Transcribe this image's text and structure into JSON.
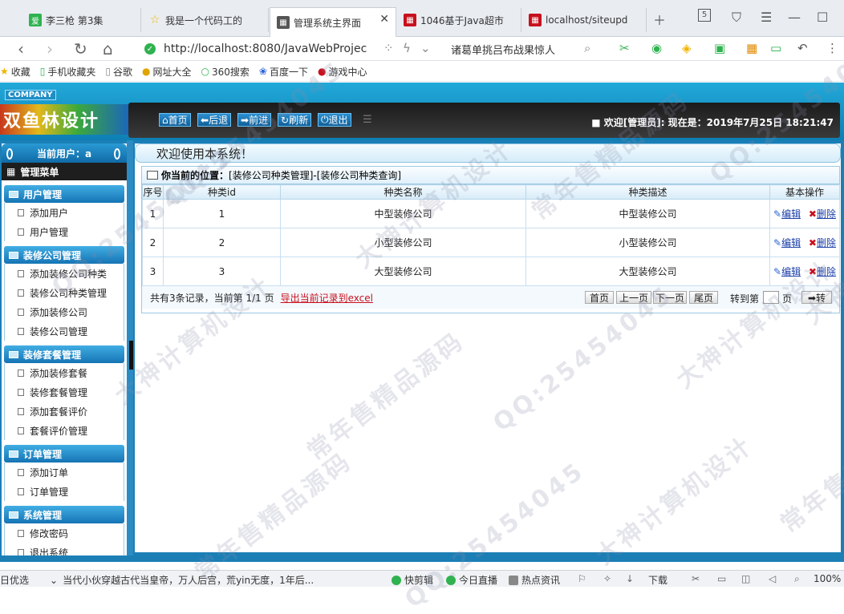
{
  "browser": {
    "tabs": [
      {
        "label": "李三枪 第3集",
        "fav_color": "#2fb24f",
        "fav_text": "爱"
      },
      {
        "label": "我是一个代码工的",
        "fav_color": "#f0b400",
        "fav_text": "☆"
      },
      {
        "label": "管理系统主界面",
        "fav_color": "#555555",
        "fav_text": "▦"
      },
      {
        "label": "1046基于Java超市",
        "fav_color": "#c8101d",
        "fav_text": "▦"
      },
      {
        "label": "localhost/siteupd",
        "fav_color": "#c8101d",
        "fav_text": "▦"
      }
    ],
    "active_tab": 2,
    "tab_count_badge": "5",
    "url": "http://localhost:8080/JavaWebProjec",
    "search_text": "诸葛单挑吕布战果惊人",
    "bookmarks": [
      {
        "label": "收藏",
        "icon": "star-icon"
      },
      {
        "label": "手机收藏夹",
        "icon": "phone-icon"
      },
      {
        "label": "谷歌",
        "icon": "page-icon"
      },
      {
        "label": "网址大全",
        "icon": "globe-icon"
      },
      {
        "label": "360搜索",
        "icon": "search-icon"
      },
      {
        "label": "百度一下",
        "icon": "paw-icon"
      },
      {
        "label": "游戏中心",
        "icon": "game-icon"
      }
    ]
  },
  "app": {
    "company": "COMPANY",
    "logo_text": "双鱼林设计",
    "menu": [
      "首页",
      "后退",
      "前进",
      "刷新",
      "退出"
    ],
    "welcome": "欢迎[管理员]:  现在是：2019年7月25日 18:21:47",
    "current_user": "当前用户：a",
    "mgmt_menu": "管理菜单",
    "welcome_bar": "欢迎使用本系统！",
    "sidebar": [
      {
        "group": "用户管理",
        "items": [
          "添加用户",
          "用户管理"
        ]
      },
      {
        "group": "装修公司管理",
        "items": [
          "添加装修公司种类",
          "装修公司种类管理",
          "添加装修公司",
          "装修公司管理"
        ]
      },
      {
        "group": "装修套餐管理",
        "items": [
          "添加装修套餐",
          "装修套餐管理",
          "添加套餐评价",
          "套餐评价管理"
        ]
      },
      {
        "group": "订单管理",
        "items": [
          "添加订单",
          "订单管理"
        ]
      },
      {
        "group": "系统管理",
        "items": [
          "修改密码",
          "退出系统"
        ]
      }
    ],
    "breadcrumb_label": "你当前的位置：",
    "breadcrumb_path": "[装修公司种类管理]-[装修公司种类查询]",
    "table": {
      "headers": [
        "序号",
        "种类id",
        "种类名称",
        "种类描述",
        "基本操作"
      ],
      "rows": [
        {
          "no": "1",
          "id": "1",
          "name": "中型装修公司",
          "desc": "中型装修公司"
        },
        {
          "no": "2",
          "id": "2",
          "name": "小型装修公司",
          "desc": "小型装修公司"
        },
        {
          "no": "3",
          "id": "3",
          "name": "大型装修公司",
          "desc": "大型装修公司"
        }
      ],
      "edit_label": "编辑",
      "delete_label": "删除"
    },
    "pager": {
      "summary": "共有3条记录，当前第 1/1 页",
      "export": "导出当前记录到excel",
      "first": "首页",
      "prev": "上一页",
      "next": "下一页",
      "last": "尾页",
      "goto_prefix": "转到第",
      "goto_suffix": "页",
      "go": "➡转"
    }
  },
  "statusbar": {
    "left": "日优选",
    "news": "当代小伙穿越古代当皇帝，万人后宫，荒yin无度，1年后...",
    "items": [
      "快剪辑",
      "今日直播",
      "热点资讯",
      "下载"
    ],
    "zoom": "100%"
  },
  "watermarks": [
    "QQ:25454045",
    "大神计算机设计",
    "常年售精品源码"
  ]
}
